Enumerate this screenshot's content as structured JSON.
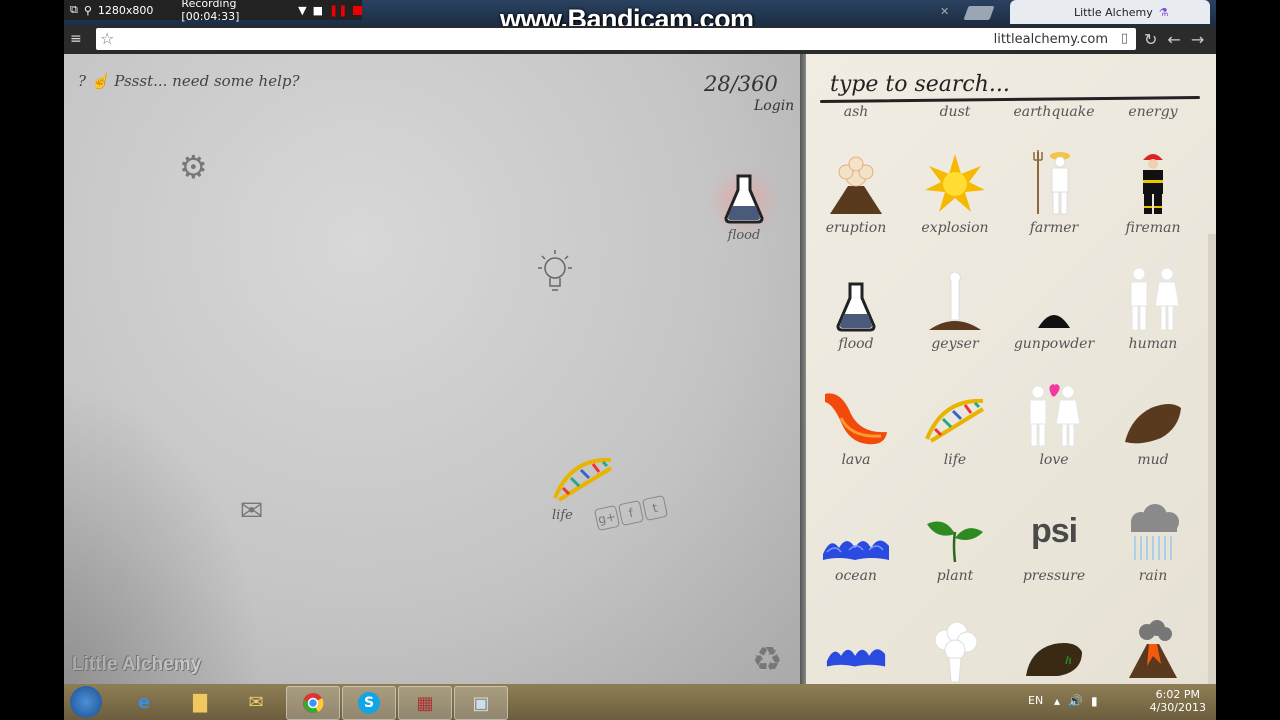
{
  "recorder": {
    "resolution": "1280x800",
    "status": "Recording [00:04:33]"
  },
  "watermark": "www.Bandicam.com",
  "browser": {
    "tab_title": "Little Alchemy",
    "url": "littlealchemy.com"
  },
  "board": {
    "help_text": "Pssst... need some help?",
    "counter": "28/360",
    "login": "Login",
    "brand": "Little Alchemy",
    "elements": [
      {
        "name": "flood",
        "icon": "flask-icon"
      },
      {
        "name": "life",
        "icon": "dna-icon"
      }
    ]
  },
  "panel": {
    "search_placeholder": "type to search...",
    "top_labels": [
      "ash",
      "dust",
      "earthquake",
      "energy"
    ],
    "items": [
      {
        "label": "eruption",
        "icon": "volcano-icon"
      },
      {
        "label": "explosion",
        "icon": "explosion-icon"
      },
      {
        "label": "farmer",
        "icon": "farmer-icon"
      },
      {
        "label": "fireman",
        "icon": "fireman-icon"
      },
      {
        "label": "flood",
        "icon": "flask-icon"
      },
      {
        "label": "geyser",
        "icon": "geyser-icon"
      },
      {
        "label": "gunpowder",
        "icon": "gunpowder-icon"
      },
      {
        "label": "human",
        "icon": "human-icon"
      },
      {
        "label": "lava",
        "icon": "lava-icon"
      },
      {
        "label": "life",
        "icon": "dna-icon"
      },
      {
        "label": "love",
        "icon": "love-icon"
      },
      {
        "label": "mud",
        "icon": "mud-icon"
      },
      {
        "label": "ocean",
        "icon": "wave-icon"
      },
      {
        "label": "plant",
        "icon": "sprout-icon"
      },
      {
        "label": "pressure",
        "icon": "psi-icon",
        "text": "psi"
      },
      {
        "label": "rain",
        "icon": "rain-cloud-icon"
      }
    ]
  },
  "taskbar": {
    "lang": "EN",
    "time": "6:02 PM",
    "date": "4/30/2013"
  }
}
